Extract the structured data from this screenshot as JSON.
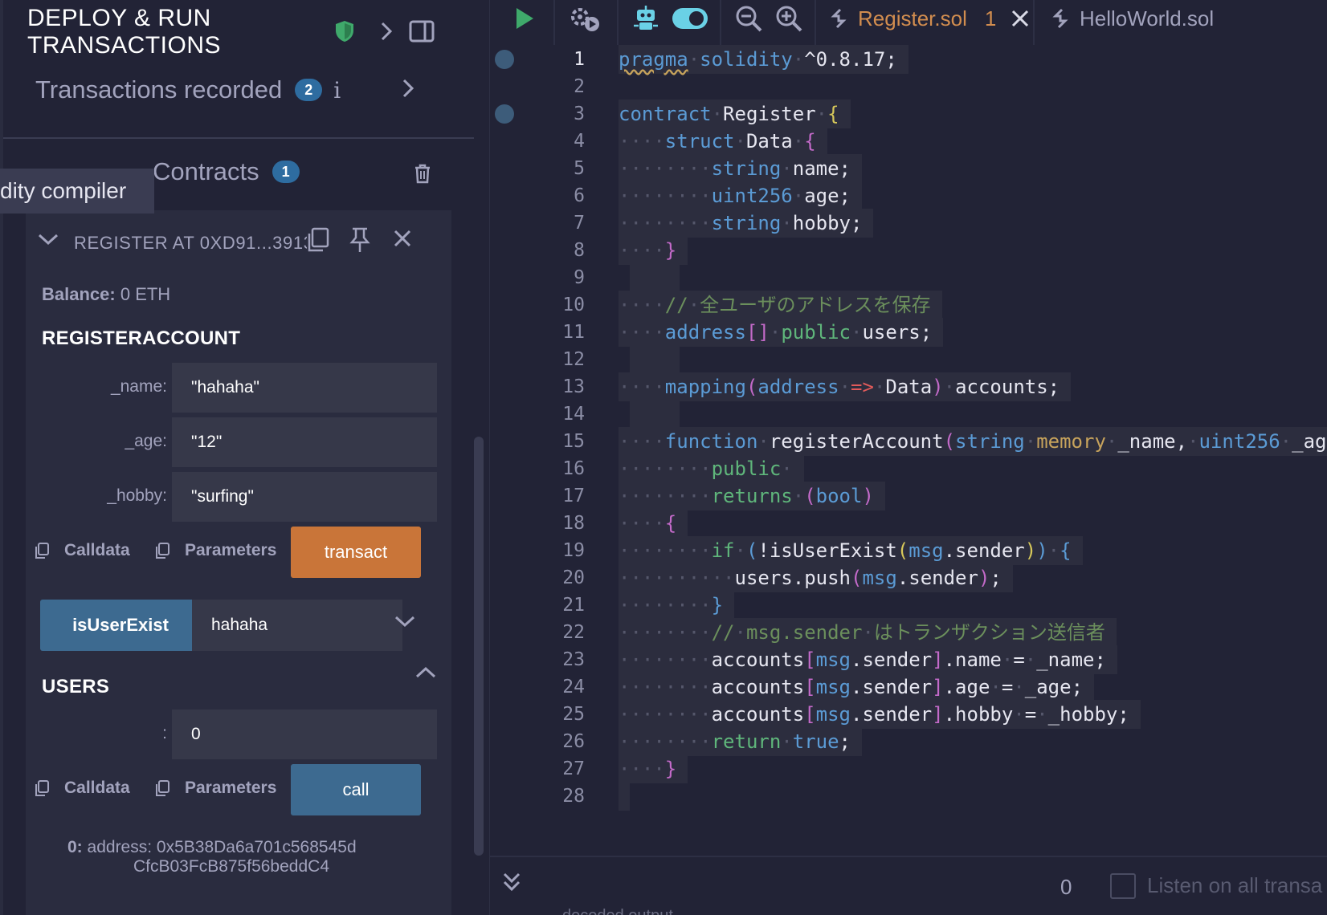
{
  "left_panel": {
    "title": "DEPLOY & RUN TRANSACTIONS",
    "transactions_recorded": {
      "label": "Transactions recorded",
      "count": "2",
      "info": "i"
    },
    "deployed_contracts": {
      "label": "Contracts",
      "count": "1"
    },
    "tooltip": "dity compiler",
    "instance": {
      "title": "REGISTER AT 0XD91...3913",
      "balance_label": "Balance:",
      "balance_value": "0 ETH",
      "functions": {
        "registerAccount": {
          "title": "REGISTERACCOUNT",
          "params": [
            {
              "label": "_name:",
              "value": "\"hahaha\""
            },
            {
              "label": "_age:",
              "value": "\"12\""
            },
            {
              "label": "_hobby:",
              "value": "\"surfing\""
            }
          ],
          "calldata_label": "Calldata",
          "parameters_label": "Parameters",
          "action_label": "transact"
        },
        "isUserExist": {
          "label": "isUserExist",
          "value": "hahaha"
        },
        "users": {
          "title": "USERS",
          "param_label": ":",
          "param_value": "0",
          "calldata_label": "Calldata",
          "parameters_label": "Parameters",
          "action_label": "call",
          "output_index": "0:",
          "output_line1": "address: 0x5B38Da6a701c568545d",
          "output_line2": "CfcB03FcB875f56beddC4"
        }
      }
    }
  },
  "editor": {
    "tabs": [
      {
        "label": "Register.sol",
        "errors": "1",
        "active": true
      },
      {
        "label": "HelloWorld.sol",
        "active": false
      }
    ],
    "line_numbers": [
      "1",
      "2",
      "3",
      "4",
      "5",
      "6",
      "7",
      "8",
      "9",
      "10",
      "11",
      "12",
      "13",
      "14",
      "15",
      "16",
      "17",
      "18",
      "19",
      "20",
      "21",
      "22",
      "23",
      "24",
      "25",
      "26",
      "27",
      "28"
    ],
    "terminal": {
      "count": "0",
      "listen_label": "Listen on all transa",
      "faded_text": "decoded output"
    }
  },
  "colors": {
    "accent_orange": "#c97539",
    "accent_blue": "#3d6a90",
    "badge_blue": "#2e6ca0",
    "bg": "#222336",
    "panel": "#2a2c3f"
  },
  "icons": [
    "shield-check-icon",
    "chevron-right-icon",
    "panel-toggle-icon",
    "info-icon",
    "trash-icon",
    "chevron-down-icon",
    "copy-icon",
    "pin-icon",
    "close-icon",
    "chevron-up-icon",
    "play-icon",
    "settings-play-icon",
    "robot-icon",
    "toggle-icon",
    "zoom-out-icon",
    "zoom-in-icon",
    "file-link-icon",
    "double-chevron-down-icon"
  ]
}
